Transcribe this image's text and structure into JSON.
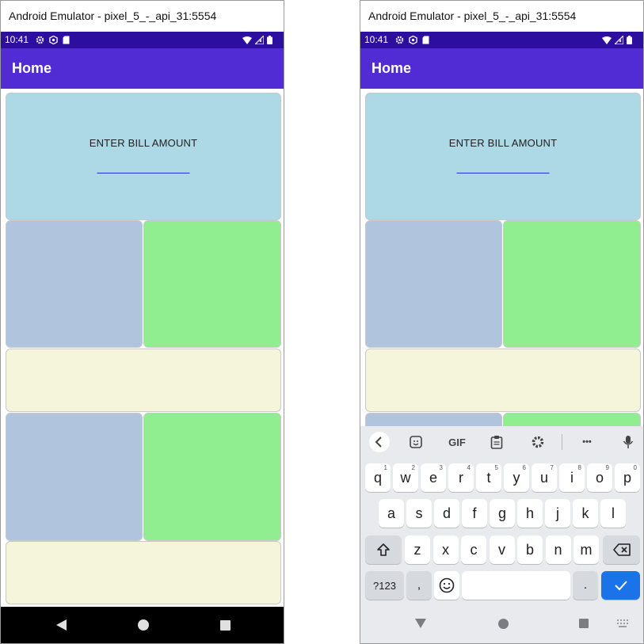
{
  "left": {
    "window_title": "Android Emulator - pixel_5_-_api_31:5554",
    "status_time": "10:41",
    "appbar_title": "Home",
    "bill_label": "ENTER BILL AMOUNT"
  },
  "right": {
    "window_title": "Android Emulator - pixel_5_-_api_31:5554",
    "status_time": "10:41",
    "appbar_title": "Home",
    "bill_label": "ENTER BILL AMOUNT",
    "keyboard": {
      "toolbar": {
        "gif_label": "GIF",
        "more_label": "•••"
      },
      "row1": [
        {
          "key": "q",
          "hint": "1"
        },
        {
          "key": "w",
          "hint": "2"
        },
        {
          "key": "e",
          "hint": "3"
        },
        {
          "key": "r",
          "hint": "4"
        },
        {
          "key": "t",
          "hint": "5"
        },
        {
          "key": "y",
          "hint": "6"
        },
        {
          "key": "u",
          "hint": "7"
        },
        {
          "key": "i",
          "hint": "8"
        },
        {
          "key": "o",
          "hint": "9"
        },
        {
          "key": "p",
          "hint": "0"
        }
      ],
      "row2": [
        "a",
        "s",
        "d",
        "f",
        "g",
        "h",
        "j",
        "k",
        "l"
      ],
      "row3": [
        "z",
        "x",
        "c",
        "v",
        "b",
        "n",
        "m"
      ],
      "symbols_label": "?123",
      "comma_label": ",",
      "period_label": "."
    }
  },
  "colors": {
    "status_bar": "#2d0fa0",
    "app_bar": "#512bd4",
    "light_blue": "#add8e6",
    "light_steel_blue": "#b0c4de",
    "light_green": "#90ee90",
    "beige": "#f5f5dc",
    "enter_key": "#1a73e8"
  },
  "icons": [
    "settings-icon",
    "android-icon",
    "sd-card-icon",
    "wifi-icon",
    "signal-icon",
    "battery-icon",
    "back-icon",
    "home-icon",
    "recents-icon",
    "chevron-left-icon",
    "sticker-icon",
    "clipboard-icon",
    "gear-icon",
    "mic-icon",
    "shift-icon",
    "backspace-icon",
    "emoji-icon",
    "check-icon",
    "keyboard-switch-icon"
  ]
}
